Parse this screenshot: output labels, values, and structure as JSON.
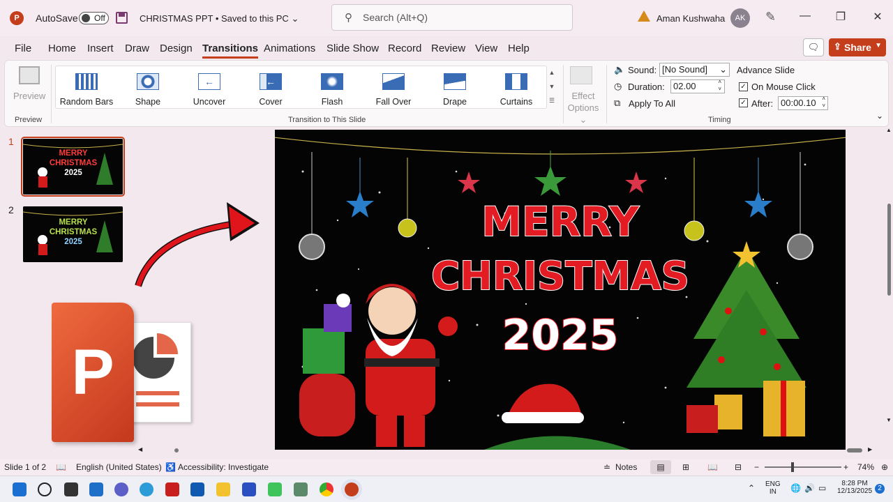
{
  "titlebar": {
    "app_icon": "P",
    "autosave_label": "AutoSave",
    "autosave_state": "Off",
    "doc_title": "CHRISTMAS PPT • Saved to this PC",
    "search_placeholder": "Search (Alt+Q)",
    "username": "Aman Kushwaha",
    "avatar_initials": "AK"
  },
  "tabs": [
    "File",
    "Home",
    "Insert",
    "Draw",
    "Design",
    "Transitions",
    "Animations",
    "Slide Show",
    "Record",
    "Review",
    "View",
    "Help"
  ],
  "active_tab": "Transitions",
  "share_label": "Share",
  "ribbon": {
    "preview_label": "Preview",
    "preview_group": "Preview",
    "transitions": [
      "Random Bars",
      "Shape",
      "Uncover",
      "Cover",
      "Flash",
      "Fall Over",
      "Drape",
      "Curtains"
    ],
    "transition_group": "Transition to This Slide",
    "effect_options_line1": "Effect",
    "effect_options_line2": "Options",
    "sound_label": "Sound:",
    "sound_value": "[No Sound]",
    "duration_label": "Duration:",
    "duration_value": "02.00",
    "apply_all": "Apply To All",
    "advance_slide": "Advance Slide",
    "on_mouse_click": "On Mouse Click",
    "after_label": "After:",
    "after_value": "00:00.10",
    "timing_group": "Timing"
  },
  "slides": [
    {
      "number": "1",
      "line1": "MERRY",
      "line2": "CHRISTMAS",
      "line3": "2025"
    },
    {
      "number": "2",
      "line1": "MERRY",
      "line2": "CHRISTMAS",
      "line3": "2025"
    }
  ],
  "main_slide": {
    "line1": "MERRY",
    "line2": "CHRISTMAS",
    "line3": "2025"
  },
  "statusbar": {
    "slide_info": "Slide 1 of 2",
    "language": "English (United States)",
    "accessibility": "Accessibility: Investigate",
    "notes": "Notes",
    "zoom": "74%"
  },
  "taskbar": {
    "lang_line1": "ENG",
    "lang_line2": "IN",
    "time": "8:28 PM",
    "date": "12/13/2025",
    "badge": "2"
  },
  "colors": {
    "accent": "#c43e1c",
    "slide_bg": "#040404",
    "title_red": "#e31b23"
  }
}
